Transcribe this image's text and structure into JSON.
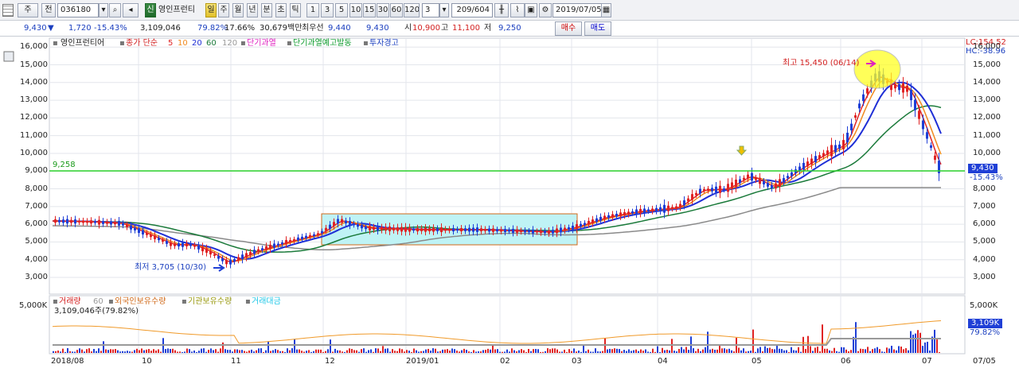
{
  "toolbar": {
    "market_selector": "주",
    "view_selector": "전",
    "stock_code": "036180",
    "credit_badge": "신",
    "stock_name": "영인프런티",
    "period_day": "일",
    "period_week": "주",
    "period_month": "월",
    "period_year": "년",
    "period_minute": "분",
    "period_second": "초",
    "period_tick": "틱",
    "intervals": [
      "1",
      "3",
      "5",
      "10",
      "15",
      "30",
      "60",
      "120"
    ],
    "interval_value": "3",
    "record_counter": "209/604",
    "date_value": "2019/07/05"
  },
  "info": {
    "price": "9,430",
    "change": "1,720",
    "change_pct": "-15.43%",
    "volume": "3,109,046",
    "vol_ratio": "79.82%",
    "turnover": "17.66%",
    "amount": "30,679백만",
    "bid_label": "최우선",
    "bid1": "9,440",
    "bid2": "9,430",
    "open_label": "시",
    "open": "10,900",
    "high_label": "고",
    "high": "11,100",
    "low_label": "저",
    "low": "9,250",
    "buy_button": "매수",
    "sell_button": "매도"
  },
  "price_legend": {
    "stock_name": "영인프런티어",
    "close_ma_label": "종가 단순",
    "ma5": "5",
    "ma10": "10",
    "ma20": "20",
    "ma60": "60",
    "ma120": "120",
    "signal1": "단기과열",
    "signal2": "단기과열예고발동",
    "signal3": "투자경고"
  },
  "lc_label": "LC:154.52",
  "hc_label": "HC:-38.96",
  "price_axis": [
    "16,000",
    "15,000",
    "14,000",
    "13,000",
    "12,000",
    "11,000",
    "10,000",
    "9,000",
    "8,000",
    "7,000",
    "6,000",
    "5,000",
    "4,000",
    "3,000"
  ],
  "hline_label": "9,258",
  "current_price_tag": "9,430",
  "current_change_tag": "-15.43%",
  "max_label": "최고 15,450 (06/14)",
  "min_label": "최저 3,705 (10/30)",
  "volume_legend": {
    "volume": "거래량",
    "ma": "60",
    "foreign": "외국인보유수량",
    "inst": "기관보유수량",
    "amount": "거래대금",
    "detail": "3,109,046주(79.82%)"
  },
  "volume_axis": "5,000K",
  "volume_axis_left": "5,000K",
  "volume_tag": "3,109K",
  "volume_pct_tag": "79.82%",
  "date_axis": [
    "2018/08",
    "10",
    "11",
    "12",
    "2019/01",
    "02",
    "03",
    "04",
    "05",
    "06",
    "07"
  ],
  "date_corner": "07/05",
  "colors": {
    "up": "#e02424",
    "down": "#1f3fd6",
    "ma5": "#e02424",
    "ma10": "#f08a1e",
    "ma20": "#1f2fd6",
    "ma60": "#1a7a3a",
    "ma120": "#8a8a8a",
    "hline": "#2bd12b",
    "box_fill": "#bff3f5",
    "box_edge": "#d06a1a"
  }
}
